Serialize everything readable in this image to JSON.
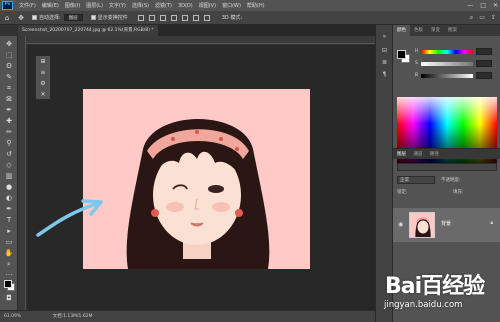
{
  "app": {
    "logo": "Ps"
  },
  "menu": [
    "文件(F)",
    "编辑(E)",
    "图像(I)",
    "图层(L)",
    "文字(Y)",
    "选择(S)",
    "滤镜(T)",
    "3D(D)",
    "视图(V)",
    "窗口(W)",
    "帮助(H)"
  ],
  "window_controls": {
    "minimize": "—",
    "maximize": "□",
    "close": "✕"
  },
  "options": {
    "auto_select_label": "自动选择:",
    "auto_select_value": "图层",
    "show_transform_label": "显示变换控件",
    "mode_label": "3D 模式:"
  },
  "document": {
    "tab_title": "Screenshot_20200707_220744.jpg @ 62.1%(背景,RGB/8) *"
  },
  "status": {
    "zoom": "61.09%",
    "doc_info": "文档:1.13M/1.62M"
  },
  "panels": {
    "color_tabs": [
      "颜色",
      "色板",
      "渐变",
      "图案"
    ],
    "layers_tabs": [
      "图层",
      "通道",
      "路径"
    ],
    "layer_mode": "正常",
    "opacity_label": "不透明度:",
    "lock_label": "锁定:",
    "fill_label": "填充:",
    "layer_name": "背景"
  },
  "colors": {
    "canvas": "#ffc9c7",
    "hair": "#2a1612",
    "headband": "#f2a79c",
    "arrow": "#7ec8ee"
  },
  "watermark": {
    "logo": "Bai百经验",
    "url": "jingyan.baidu.com"
  }
}
